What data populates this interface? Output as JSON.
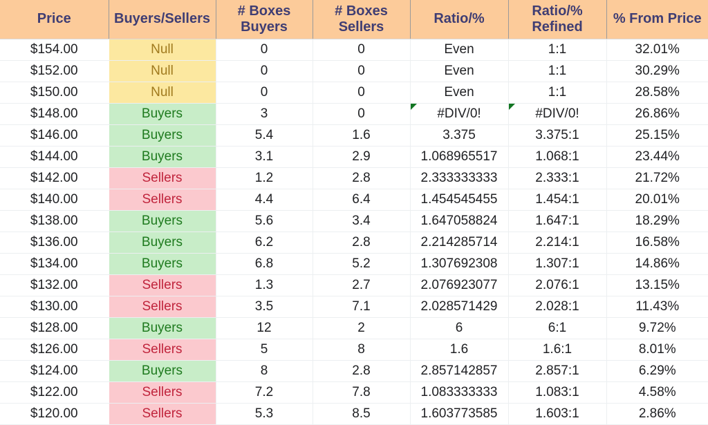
{
  "table": {
    "columns": [
      {
        "key": "price",
        "label": "Price",
        "name": "column-header-price"
      },
      {
        "key": "state",
        "label": "Buyers/Sellers",
        "name": "column-header-buyers-sellers"
      },
      {
        "key": "boxbuy",
        "label": "# Boxes\nBuyers",
        "name": "column-header-boxes-buyers"
      },
      {
        "key": "boxsell",
        "label": "# Boxes\nSellers",
        "name": "column-header-boxes-sellers"
      },
      {
        "key": "ratio",
        "label": "Ratio/%",
        "name": "column-header-ratio"
      },
      {
        "key": "ratioref",
        "label": "Ratio/%\nRefined",
        "name": "column-header-ratio-refined"
      },
      {
        "key": "frompct",
        "label": "% From Price",
        "name": "column-header-pct-from-price"
      }
    ],
    "colors": {
      "header_bg": "#FCCB9A",
      "header_text": "#3F3D73",
      "null_bg": "#FCE8A0",
      "null_text": "#A07A1E",
      "buyers_bg": "#C8EDC8",
      "buyers_text": "#1E7A1E",
      "sellers_bg": "#FBC9CE",
      "sellers_text": "#C0243C",
      "error_flag": "#127622",
      "grid_line": "#ECEFF1"
    },
    "rows": [
      {
        "price": "$154.00",
        "state": "Null",
        "boxbuy": "0",
        "boxsell": "0",
        "ratio": "Even",
        "ratioref": "1:1",
        "frompct": "32.01%",
        "error": false
      },
      {
        "price": "$152.00",
        "state": "Null",
        "boxbuy": "0",
        "boxsell": "0",
        "ratio": "Even",
        "ratioref": "1:1",
        "frompct": "30.29%",
        "error": false
      },
      {
        "price": "$150.00",
        "state": "Null",
        "boxbuy": "0",
        "boxsell": "0",
        "ratio": "Even",
        "ratioref": "1:1",
        "frompct": "28.58%",
        "error": false
      },
      {
        "price": "$148.00",
        "state": "Buyers",
        "boxbuy": "3",
        "boxsell": "0",
        "ratio": "#DIV/0!",
        "ratioref": "#DIV/0!",
        "frompct": "26.86%",
        "error": true
      },
      {
        "price": "$146.00",
        "state": "Buyers",
        "boxbuy": "5.4",
        "boxsell": "1.6",
        "ratio": "3.375",
        "ratioref": "3.375:1",
        "frompct": "25.15%",
        "error": false
      },
      {
        "price": "$144.00",
        "state": "Buyers",
        "boxbuy": "3.1",
        "boxsell": "2.9",
        "ratio": "1.068965517",
        "ratioref": "1.068:1",
        "frompct": "23.44%",
        "error": false
      },
      {
        "price": "$142.00",
        "state": "Sellers",
        "boxbuy": "1.2",
        "boxsell": "2.8",
        "ratio": "2.333333333",
        "ratioref": "2.333:1",
        "frompct": "21.72%",
        "error": false
      },
      {
        "price": "$140.00",
        "state": "Sellers",
        "boxbuy": "4.4",
        "boxsell": "6.4",
        "ratio": "1.454545455",
        "ratioref": "1.454:1",
        "frompct": "20.01%",
        "error": false
      },
      {
        "price": "$138.00",
        "state": "Buyers",
        "boxbuy": "5.6",
        "boxsell": "3.4",
        "ratio": "1.647058824",
        "ratioref": "1.647:1",
        "frompct": "18.29%",
        "error": false
      },
      {
        "price": "$136.00",
        "state": "Buyers",
        "boxbuy": "6.2",
        "boxsell": "2.8",
        "ratio": "2.214285714",
        "ratioref": "2.214:1",
        "frompct": "16.58%",
        "error": false
      },
      {
        "price": "$134.00",
        "state": "Buyers",
        "boxbuy": "6.8",
        "boxsell": "5.2",
        "ratio": "1.307692308",
        "ratioref": "1.307:1",
        "frompct": "14.86%",
        "error": false
      },
      {
        "price": "$132.00",
        "state": "Sellers",
        "boxbuy": "1.3",
        "boxsell": "2.7",
        "ratio": "2.076923077",
        "ratioref": "2.076:1",
        "frompct": "13.15%",
        "error": false
      },
      {
        "price": "$130.00",
        "state": "Sellers",
        "boxbuy": "3.5",
        "boxsell": "7.1",
        "ratio": "2.028571429",
        "ratioref": "2.028:1",
        "frompct": "11.43%",
        "error": false
      },
      {
        "price": "$128.00",
        "state": "Buyers",
        "boxbuy": "12",
        "boxsell": "2",
        "ratio": "6",
        "ratioref": "6:1",
        "frompct": "9.72%",
        "error": false
      },
      {
        "price": "$126.00",
        "state": "Sellers",
        "boxbuy": "5",
        "boxsell": "8",
        "ratio": "1.6",
        "ratioref": "1.6:1",
        "frompct": "8.01%",
        "error": false
      },
      {
        "price": "$124.00",
        "state": "Buyers",
        "boxbuy": "8",
        "boxsell": "2.8",
        "ratio": "2.857142857",
        "ratioref": "2.857:1",
        "frompct": "6.29%",
        "error": false
      },
      {
        "price": "$122.00",
        "state": "Sellers",
        "boxbuy": "7.2",
        "boxsell": "7.8",
        "ratio": "1.083333333",
        "ratioref": "1.083:1",
        "frompct": "4.58%",
        "error": false
      },
      {
        "price": "$120.00",
        "state": "Sellers",
        "boxbuy": "5.3",
        "boxsell": "8.5",
        "ratio": "1.603773585",
        "ratioref": "1.603:1",
        "frompct": "2.86%",
        "error": false
      }
    ]
  }
}
